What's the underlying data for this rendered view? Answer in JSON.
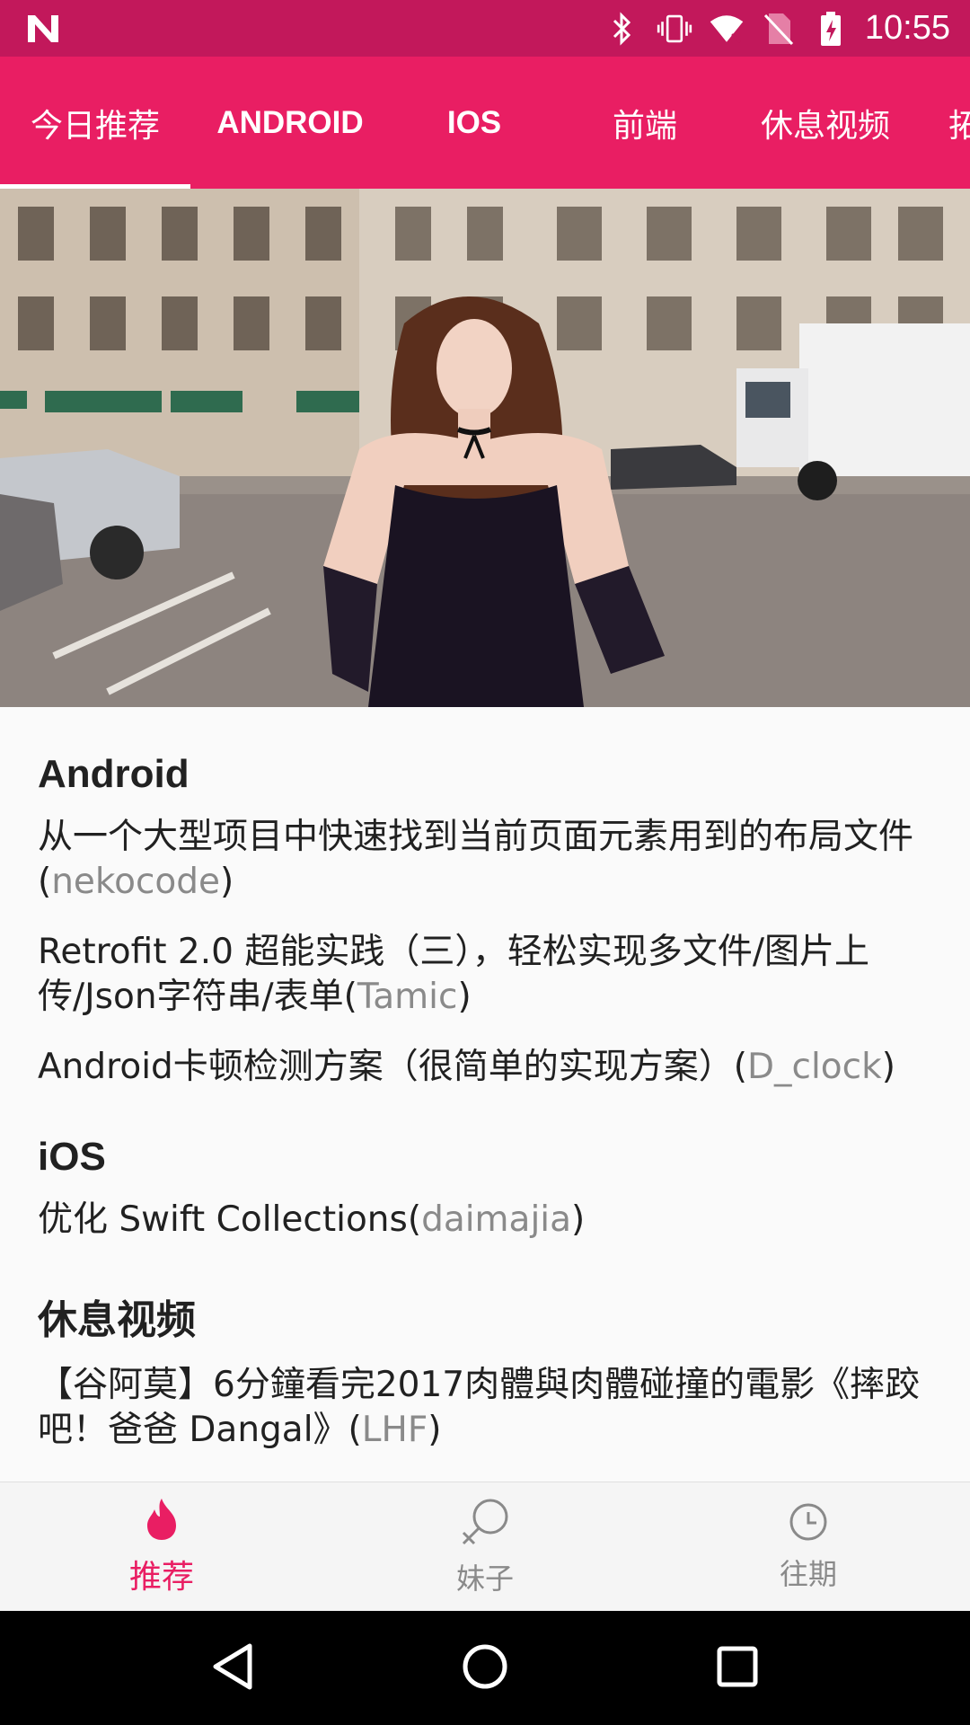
{
  "status_bar": {
    "time": "10:55"
  },
  "tabs": [
    {
      "label": "今日推荐",
      "active": true
    },
    {
      "label": "ANDROID",
      "active": false
    },
    {
      "label": "IOS",
      "active": false
    },
    {
      "label": "前端",
      "active": false
    },
    {
      "label": "休息视频",
      "active": false
    },
    {
      "label": "拓",
      "active": false
    }
  ],
  "sections": {
    "android": {
      "title": "Android",
      "items": [
        {
          "text": "从一个大型项目中快速找到当前页面元素用到的布局文件(",
          "author": "nekocode",
          "close": ")"
        },
        {
          "text": "Retrofit 2.0 超能实践（三），轻松实现多文件/图片上传/Json字符串/表单(",
          "author": "Tamic",
          "close": ")"
        },
        {
          "text": "Android卡顿检测方案（很简单的实现方案）(",
          "author": "D_clock",
          "close": ")"
        }
      ]
    },
    "ios": {
      "title": "iOS",
      "items": [
        {
          "text": "优化 Swift Collections(",
          "author": "daimajia",
          "close": ")"
        }
      ]
    },
    "video": {
      "title": "休息视频",
      "items": [
        {
          "text": "【谷阿莫】6分鐘看完2017肉體與肉體碰撞的電影《摔跤吧！爸爸 Dangal》(",
          "author": "LHF",
          "close": ")"
        }
      ]
    }
  },
  "bottom_nav": [
    {
      "label": "推荐",
      "icon": "flame-icon",
      "active": true
    },
    {
      "label": "妹子",
      "icon": "female-symbol-icon",
      "active": false
    },
    {
      "label": "往期",
      "icon": "clock-icon",
      "active": false
    }
  ],
  "colors": {
    "primary": "#e91e63",
    "primary_dark": "#c2185b",
    "author_gray": "#8a8a8a"
  }
}
